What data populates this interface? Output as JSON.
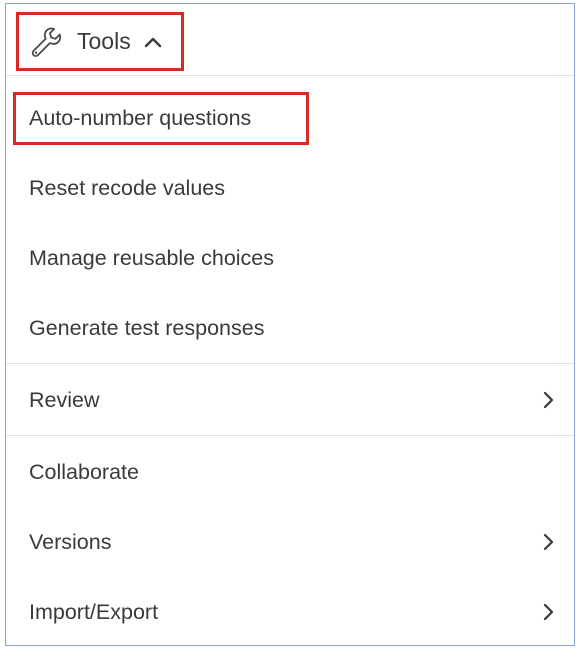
{
  "toolbar": {
    "tools_label": "Tools",
    "tools_icon": "wrench-icon",
    "caret_icon": "chevron-up-icon"
  },
  "menu": {
    "items": [
      {
        "label": "Auto-number questions",
        "has_submenu": false
      },
      {
        "label": "Reset recode values",
        "has_submenu": false
      },
      {
        "label": "Manage reusable choices",
        "has_submenu": false
      },
      {
        "label": "Generate test responses",
        "has_submenu": false
      },
      {
        "label": "Review",
        "has_submenu": true
      },
      {
        "label": "Collaborate",
        "has_submenu": false
      },
      {
        "label": "Versions",
        "has_submenu": true
      },
      {
        "label": "Import/Export",
        "has_submenu": true
      }
    ]
  },
  "colors": {
    "highlight_border": "#d62b22",
    "frame_border": "#8aa6d6",
    "text": "#3a3a3a",
    "divider": "#e2e2e2"
  }
}
